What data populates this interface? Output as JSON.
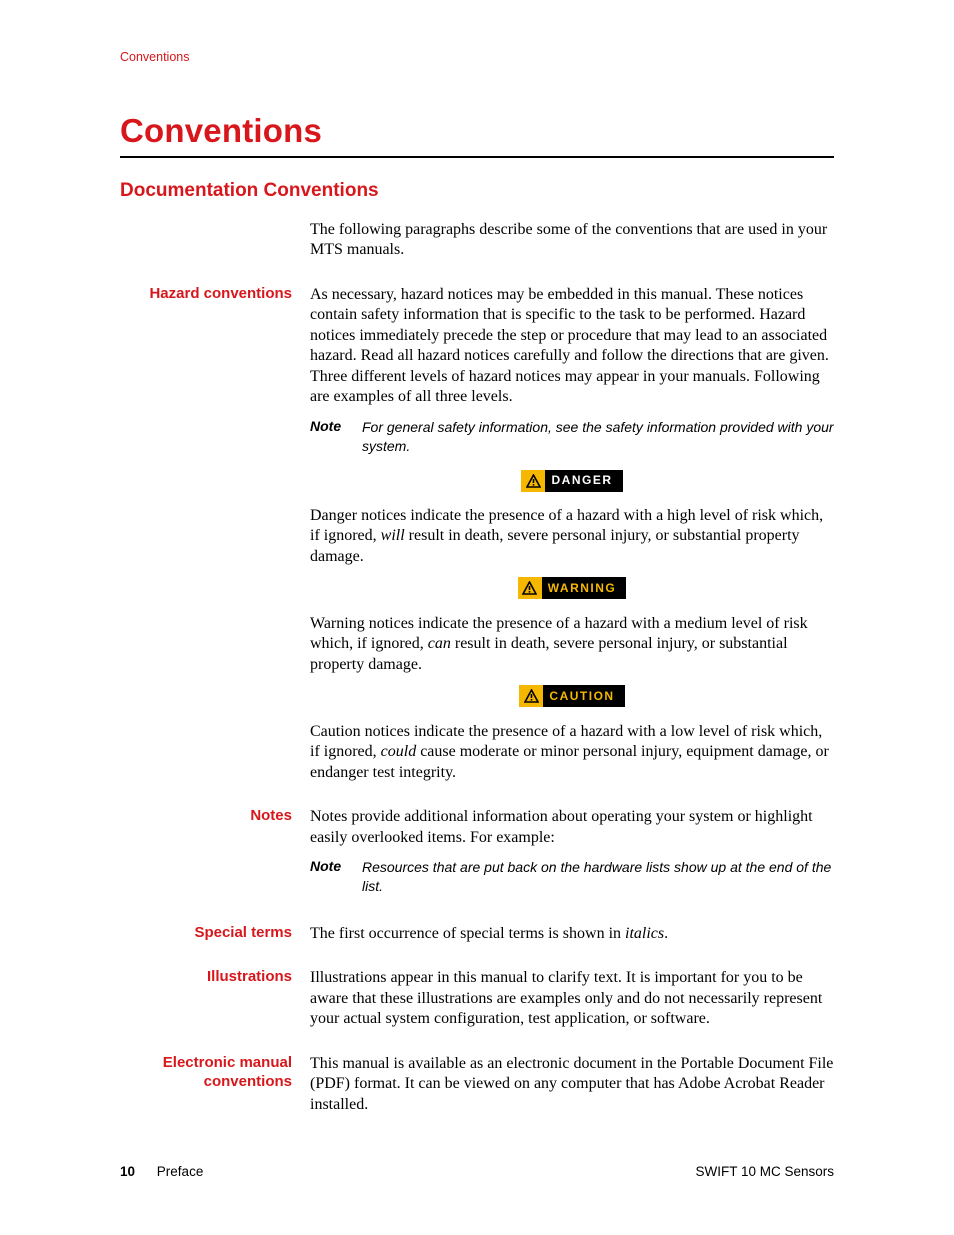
{
  "header": {
    "running": "Conventions"
  },
  "chapter": {
    "title": "Conventions"
  },
  "section": {
    "title": "Documentation Conventions"
  },
  "intro": "The following paragraphs describe some of the conventions that are used in your MTS manuals.",
  "hazard": {
    "label": "Hazard conventions",
    "text": "As necessary, hazard notices may be embedded in this manual. These notices contain safety information that is specific to the task to be performed. Hazard notices immediately precede the step or procedure that may lead to an associated hazard. Read all hazard notices carefully and follow the directions that are given. Three different levels of hazard notices may appear in your manuals. Following are examples of all three levels.",
    "note_label": "Note",
    "note_text": "For general safety information, see the safety information provided with your system.",
    "danger_badge": "DANGER",
    "danger_pre": "Danger notices indicate the presence of a hazard with a high level of risk which, if ignored, ",
    "danger_em": "will",
    "danger_post": " result in death, severe personal injury, or substantial property damage.",
    "warning_badge": "WARNING",
    "warning_pre": "Warning notices indicate the presence of a hazard with a medium level of risk which, if ignored, ",
    "warning_em": "can",
    "warning_post": " result in death, severe personal injury, or substantial property damage.",
    "caution_badge": "CAUTION",
    "caution_pre": "Caution notices indicate the presence of a hazard with a low level of risk which, if ignored, ",
    "caution_em": "could",
    "caution_post": " cause moderate or minor personal injury, equipment damage, or endanger test integrity."
  },
  "notes": {
    "label": "Notes",
    "text": "Notes provide additional information about operating your system or highlight easily overlooked items. For example:",
    "note_label": "Note",
    "note_text": "Resources that are put back on the hardware lists show up at the end of the list."
  },
  "special": {
    "label": "Special terms",
    "pre": "The first occurrence of special terms is shown in ",
    "em": "italics",
    "post": "."
  },
  "illus": {
    "label": "Illustrations",
    "text": "Illustrations appear in this manual to clarify text. It is important for you to be aware that these illustrations are examples only and do not necessarily represent your actual system configuration, test application, or software."
  },
  "emanual": {
    "label": "Electronic manual conventions",
    "text": "This manual is available as an electronic document in the Portable Document File (PDF) format. It can be viewed on any computer that has Adobe Acrobat Reader installed."
  },
  "footer": {
    "page_num": "10",
    "section": "Preface",
    "doc": "SWIFT 10 MC Sensors"
  }
}
